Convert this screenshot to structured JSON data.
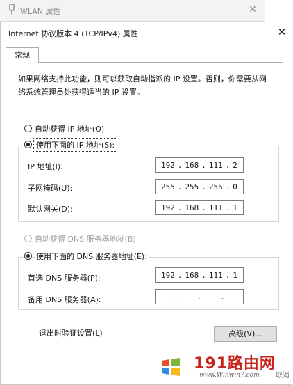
{
  "background_window": {
    "title": "WLAN 属性",
    "close_glyph": "✕"
  },
  "dialog": {
    "title": "Internet 协议版本 4 (TCP/IPv4) 属性",
    "close_glyph": "✕"
  },
  "tabs": [
    {
      "label": "常规",
      "selected": true
    }
  ],
  "description": "如果网络支持此功能，则可以获取自动指派的 IP 设置。否则，你需要从网络系统管理员处获得适当的 IP 设置。",
  "ip": {
    "auto_label": "自动获得 IP 地址(O)",
    "manual_label": "使用下面的 IP 地址(S):",
    "manual_selected": true,
    "fields": [
      {
        "label": "IP 地址(I):",
        "octets": [
          "192",
          "168",
          "111",
          "2"
        ]
      },
      {
        "label": "子网掩码(U):",
        "octets": [
          "255",
          "255",
          "255",
          "0"
        ]
      },
      {
        "label": "默认网关(D):",
        "octets": [
          "192",
          "168",
          "111",
          "1"
        ]
      }
    ]
  },
  "dns": {
    "auto_label": "自动获得 DNS 服务器地址(B)",
    "manual_label": "使用下面的 DNS 服务器地址(E):",
    "manual_selected": true,
    "fields": [
      {
        "label": "首选 DNS 服务器(P):",
        "octets": [
          "192",
          "168",
          "111",
          "1"
        ]
      },
      {
        "label": "备用 DNS 服务器(A):",
        "octets": [
          "",
          "",
          "",
          ""
        ]
      }
    ]
  },
  "validate_label": "退出时验证设置(L)",
  "validate_checked": false,
  "advanced_button": "高级(V)...",
  "watermark": {
    "text": "191路由网",
    "site": "www.Winwin7.com",
    "partial": "取消"
  },
  "colors": {
    "accent": "#0078d7",
    "disabled_text": "#a0a0a0",
    "watermark_red": "#c8231e"
  }
}
